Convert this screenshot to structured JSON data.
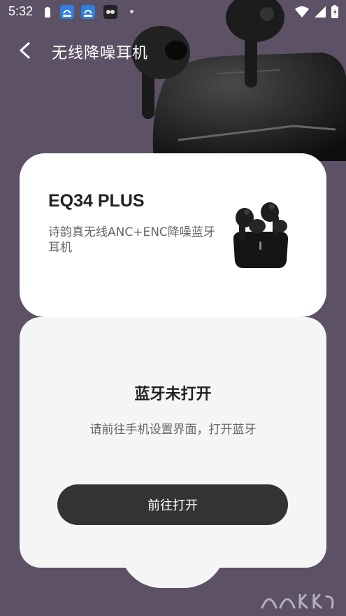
{
  "status_bar": {
    "time": "5:32",
    "icons": [
      "lock-icon",
      "app-notification-icon",
      "app-notification-icon",
      "app-icon",
      "dot-icon",
      "wifi-icon",
      "signal-icon",
      "battery-icon"
    ]
  },
  "header": {
    "back_icon": "chevron-left-icon",
    "title": "无线降噪耳机"
  },
  "product": {
    "name": "EQ34 PLUS",
    "description": "诗韵真无线ANC+ENC降噪蓝牙耳机"
  },
  "bluetooth_panel": {
    "title": "蓝牙未打开",
    "message": "请前往手机设置界面，打开蓝牙",
    "button_label": "前往打开"
  },
  "colors": {
    "background": "#5d5166",
    "card": "#ffffff",
    "panel": "#f5f5f5",
    "button": "#333333"
  }
}
